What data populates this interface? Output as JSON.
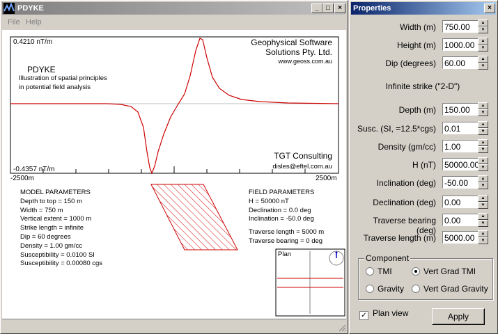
{
  "main_window": {
    "title": "PDYKE",
    "menu": [
      "File",
      "Help"
    ],
    "controls": {
      "minimize": "_",
      "maximize": "□",
      "close": "×"
    }
  },
  "plot": {
    "y_max_label": "0.4210 nT/m",
    "y_min_label": "-0.4357 nT/m",
    "x_left_label": "-2500m",
    "x_right_label": "2500m",
    "app_name": "PDYKE",
    "subtitle_line1": "Illustration of spatial principles",
    "subtitle_line2": "in potential field analysis",
    "company_line1": "Geophysical Software",
    "company_line2": "Solutions Pty. Ltd.",
    "company_web": "www.geoss.com.au",
    "consult_name": "TGT Consulting",
    "consult_email": "disles@eftel.com.au",
    "curve_color": "#cc0000"
  },
  "model_params": {
    "heading": "MODEL PARAMETERS",
    "lines": [
      "Depth to top = 150 m",
      "Width = 750 m",
      "Vertical extent = 1000 m",
      "Strike length = infinite",
      "Dip = 60 degrees",
      "Density = 1.00 gm/cc",
      "Susceptibility = 0.0100 SI",
      "Susceptibility = 0.00080 cgs"
    ]
  },
  "field_params": {
    "heading": "FIELD PARAMETERS",
    "lines": [
      "H = 50000 nT",
      "Declination = 0.0 deg",
      "Inclination = -50.0 deg",
      "",
      "Traverse length = 5000 m",
      "Traverse bearing = 0 deg"
    ]
  },
  "plan": {
    "label": "Plan"
  },
  "properties": {
    "title": "Properties",
    "close": "×",
    "fields": [
      {
        "label": "Width (m)",
        "value": "750.00"
      },
      {
        "label": "Height (m)",
        "value": "1000.00"
      },
      {
        "label": "Dip (degrees)",
        "value": "60.00"
      },
      {
        "label": "Depth (m)",
        "value": "150.00"
      },
      {
        "label": "Susc. (SI, =12.5*cgs)",
        "value": "0.01"
      },
      {
        "label": "Density (gm/cc)",
        "value": "1.00"
      },
      {
        "label": "H (nT)",
        "value": "50000.00"
      },
      {
        "label": "Inclination (deg)",
        "value": "-50.00"
      },
      {
        "label": "Declination (deg)",
        "value": "0.00"
      },
      {
        "label": "Traverse bearing (deg)",
        "value": "0.00"
      },
      {
        "label": "Traverse length (m)",
        "value": "5000.00"
      }
    ],
    "strike_note": "Infinite strike (\"2-D\")",
    "component": {
      "title": "Component",
      "options": [
        "TMI",
        "Vert Grad TMI",
        "Gravity",
        "Vert Grad Gravity"
      ],
      "selected": "Vert Grad TMI"
    },
    "plan_view": {
      "label": "Plan view",
      "checked": true
    },
    "apply_label": "Apply"
  }
}
